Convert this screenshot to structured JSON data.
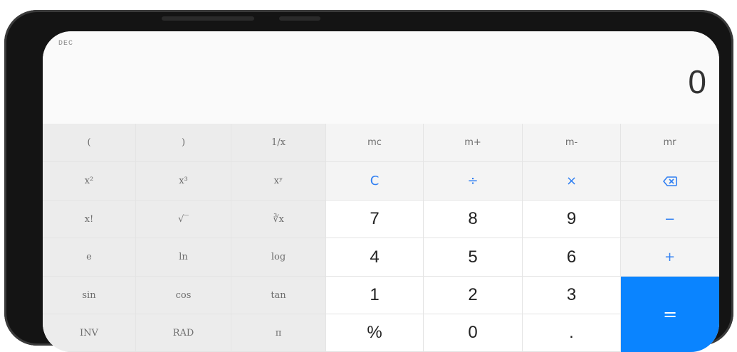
{
  "display": {
    "mode": "DEC",
    "value": "0"
  },
  "keys": {
    "open_paren": "(",
    "close_paren": ")",
    "reciprocal": "1/x",
    "mc": "mc",
    "m_plus": "m+",
    "m_minus": "m-",
    "mr": "mr",
    "square": "x²",
    "cube": "x³",
    "power": "xʸ",
    "clear": "C",
    "divide": "÷",
    "multiply": "×",
    "backspace_icon": "backspace-icon",
    "factorial": "x!",
    "sqrt": "√‾",
    "cbrt": "∛x",
    "seven": "7",
    "eight": "8",
    "nine": "9",
    "minus": "−",
    "e": "e",
    "ln": "ln",
    "log": "log",
    "four": "4",
    "five": "5",
    "six": "6",
    "plus": "+",
    "sin": "sin",
    "cos": "cos",
    "tan": "tan",
    "one": "1",
    "two": "2",
    "three": "3",
    "equals": "=",
    "inv": "INV",
    "rad": "RAD",
    "pi": "π",
    "percent": "%",
    "zero": "0",
    "decimal": "."
  },
  "colors": {
    "accent": "#2f7ff2",
    "equals_bg": "#0a84ff"
  }
}
